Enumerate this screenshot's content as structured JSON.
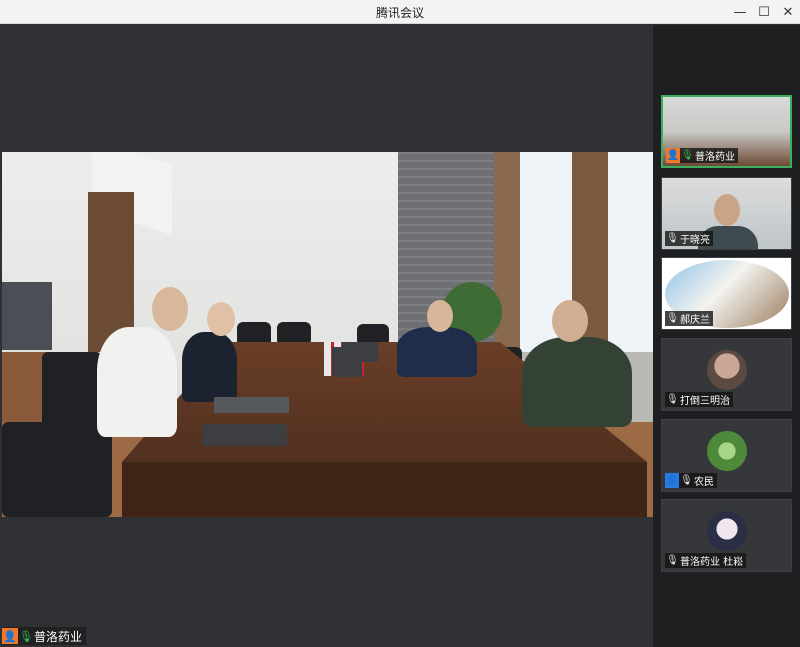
{
  "window": {
    "title": "腾讯会议",
    "controls": {
      "minimize": "—",
      "maximize": "☐",
      "close": "✕"
    }
  },
  "main_speaker": {
    "name": "普洛药业",
    "mic": "on",
    "badge_color": "#f0782a"
  },
  "participants": [
    {
      "name": "普洛药业",
      "mic": "on",
      "badge": "user-orange",
      "video": "room",
      "active": true
    },
    {
      "name": "于晓亮",
      "mic": "muted",
      "video": "camera"
    },
    {
      "name": "郝庆兰",
      "mic": "on-white",
      "video": "camera-oval"
    },
    {
      "name": "打倒三明治",
      "mic": "muted",
      "video": "avatar"
    },
    {
      "name": "农民",
      "mic": "on-white",
      "badge": "user-blue",
      "video": "avatar"
    },
    {
      "name": "普洛药业 杜崧",
      "mic": "muted",
      "video": "avatar"
    }
  ],
  "icons": {
    "user": "👤",
    "mic_on": "🎙",
    "mic_muted": "🎙"
  },
  "colors": {
    "active_border": "#3aaf5d",
    "mic_green": "#33c157",
    "orange_badge": "#f0782a",
    "blue_badge": "#2b78e4"
  }
}
